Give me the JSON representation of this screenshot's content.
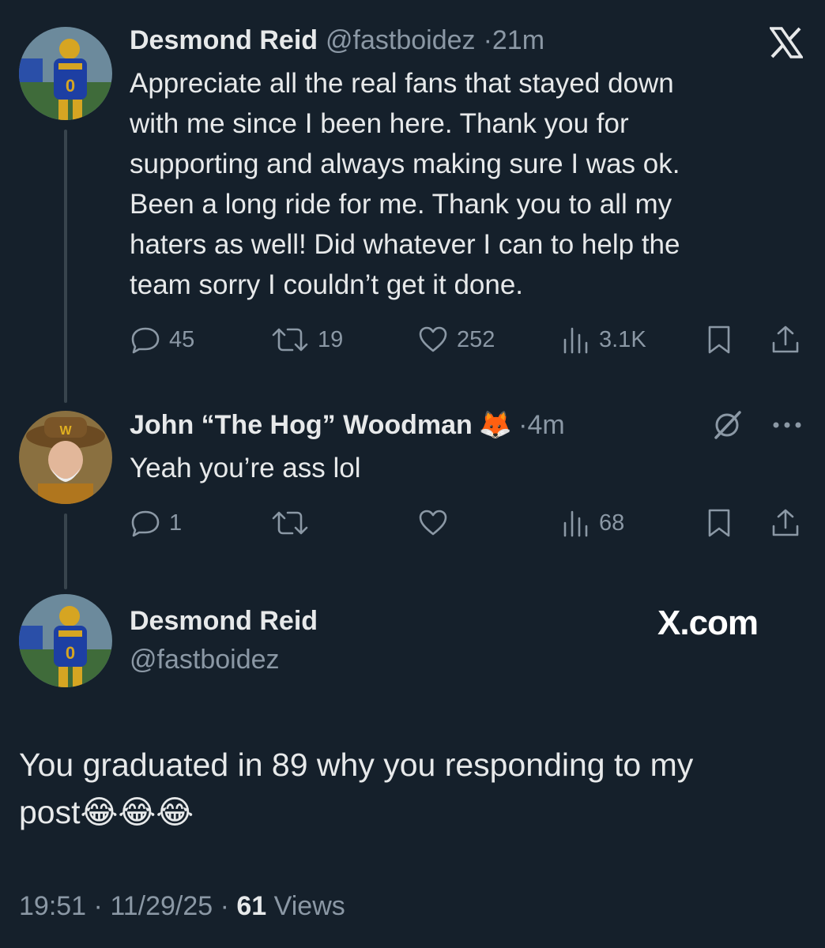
{
  "tweet1": {
    "name": "Desmond Reid",
    "handle": "@fastboidez",
    "time": "·21m",
    "lines": [
      "Appreciate all the real fans that stayed down",
      "with me since I been here. Thank you for",
      "supporting and always making sure I was ok.",
      "Been a long ride for me. Thank you to all my",
      "haters as well! Did whatever I can to help the",
      "team sorry I couldn’t get it done."
    ],
    "replies": "45",
    "reposts": "19",
    "likes": "252",
    "views": "3.1K"
  },
  "tweet2": {
    "name": "John “The Hog” Woodman",
    "emoji": "🦊",
    "time": "·4m",
    "text": "Yeah you’re ass lol",
    "replies": "1",
    "views": "68"
  },
  "tweet3": {
    "name": "Desmond Reid",
    "handle": "@fastboidez",
    "brand": "X.com",
    "text_line1": "You graduated in 89 why you responding to my",
    "text_line2": "post😂😂😂",
    "time": "19:51",
    "date": "11/29/25",
    "views_count": "61",
    "views_label": "Views"
  },
  "icons": [
    "x-logo-icon",
    "reply-icon",
    "repost-icon",
    "like-icon",
    "views-icon",
    "bookmark-icon",
    "share-icon",
    "grok-icon",
    "more-icon"
  ],
  "colors": {
    "background": "#15202b",
    "text": "#e7e9ea",
    "muted": "#8b98a5",
    "line": "#38444d"
  }
}
